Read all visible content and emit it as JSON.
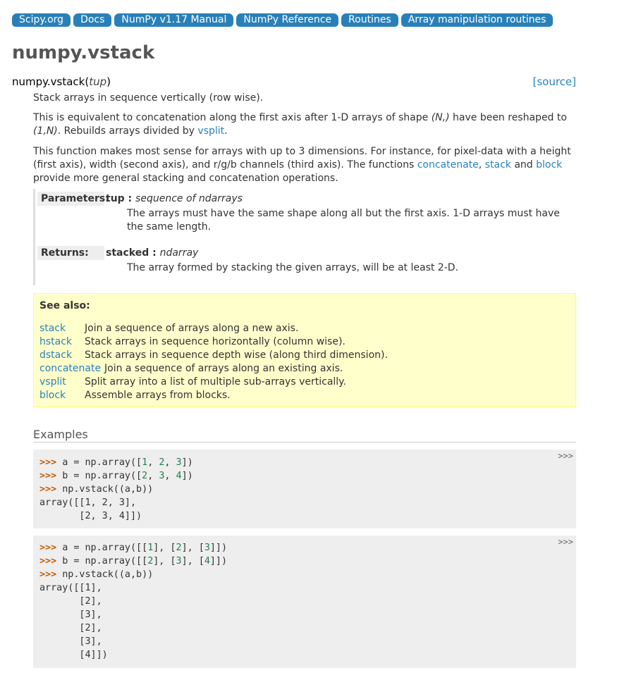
{
  "breadcrumbs": [
    "Scipy.org",
    "Docs",
    "NumPy v1.17 Manual",
    "NumPy Reference",
    "Routines",
    "Array manipulation routines"
  ],
  "page_title": "numpy.vstack",
  "signature": {
    "name": "numpy.vstack",
    "args": "tup",
    "source_label": "[source]"
  },
  "summary": "Stack arrays in sequence vertically (row wise).",
  "para2": {
    "pre": "This is equivalent to concatenation along the first axis after 1-D arrays of shape ",
    "shape1": "(N,)",
    "mid": " have been reshaped to ",
    "shape2": "(1,N)",
    "post": ". Rebuilds arrays divided by ",
    "link": "vsplit",
    "end": "."
  },
  "para3": {
    "pre": "This function makes most sense for arrays with up to 3 dimensions. For instance, for pixel-data with a height (first axis), width (second axis), and r/g/b channels (third axis). The functions ",
    "link1": "concatenate",
    "sep1": ", ",
    "link2": "stack",
    "sep2": " and ",
    "link3": "block",
    "post": " provide more general stacking and concatenation operations."
  },
  "parameters": {
    "label": "Parameters:",
    "name": "tup",
    "sep": " : ",
    "type": "sequence of ndarrays",
    "desc": "The arrays must have the same shape along all but the first axis. 1-D arrays must have the same length."
  },
  "returns": {
    "label": "Returns:",
    "name": "stacked",
    "sep": " : ",
    "type": "ndarray",
    "desc": "The array formed by stacking the given arrays, will be at least 2-D."
  },
  "see_also": {
    "title": "See also:",
    "items": [
      {
        "name": "stack",
        "desc": "Join a sequence of arrays along a new axis."
      },
      {
        "name": "hstack",
        "desc": "Stack arrays in sequence horizontally (column wise)."
      },
      {
        "name": "dstack",
        "desc": "Stack arrays in sequence depth wise (along third dimension)."
      },
      {
        "name": "concatenate",
        "desc": "Join a sequence of arrays along an existing axis."
      },
      {
        "name": "vsplit",
        "desc": "Split array into a list of multiple sub-arrays vertically."
      },
      {
        "name": "block",
        "desc": "Assemble arrays from blocks."
      }
    ]
  },
  "examples": {
    "heading": "Examples",
    "toggle": ">>>",
    "block1": [
      [
        ">>> ",
        "a = np.array([",
        "1",
        ", ",
        "2",
        ", ",
        "3",
        "])"
      ],
      [
        ">>> ",
        "b = np.array([",
        "2",
        ", ",
        "3",
        ", ",
        "4",
        "])"
      ],
      [
        ">>> ",
        "np.vstack((a,b))"
      ],
      [
        "",
        "array([[1, 2, 3],"
      ],
      [
        "",
        "       [2, 3, 4]])"
      ]
    ],
    "block2": [
      [
        ">>> ",
        "a = np.array([[",
        "1",
        "], [",
        "2",
        "], [",
        "3",
        "]])"
      ],
      [
        ">>> ",
        "b = np.array([[",
        "2",
        "], [",
        "3",
        "], [",
        "4",
        "]])"
      ],
      [
        ">>> ",
        "np.vstack((a,b))"
      ],
      [
        "",
        "array([[1],"
      ],
      [
        "",
        "       [2],"
      ],
      [
        "",
        "       [3],"
      ],
      [
        "",
        "       [2],"
      ],
      [
        "",
        "       [3],"
      ],
      [
        "",
        "       [4]])"
      ]
    ]
  }
}
